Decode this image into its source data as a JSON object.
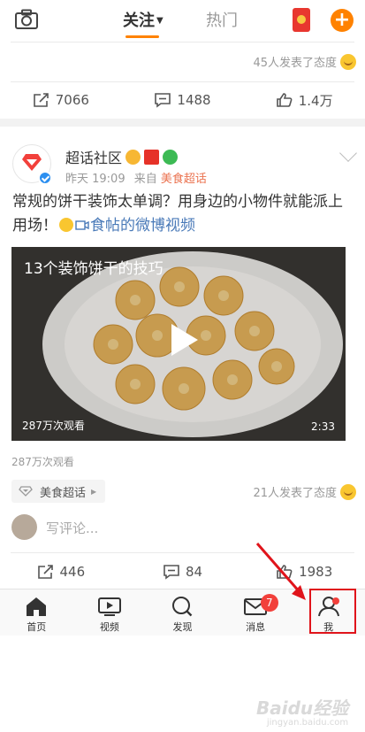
{
  "topbar": {
    "tab_follow": "关注",
    "tab_hot": "热门",
    "accent": "#ff8200"
  },
  "prev_post": {
    "reaction_text": "45人发表了态度",
    "repost_count": "7066",
    "comment_count": "1488",
    "like_count": "1.4万"
  },
  "post": {
    "author": "超话社区",
    "time": "昨天 19:09",
    "from_prefix": "来自",
    "source": "美食超话",
    "text_main": "常规的饼干装饰太单调？用身边的小物件就能派上用场！",
    "link_text": "食帖的微博视频",
    "video": {
      "title": "13个装饰饼干的技巧",
      "views": "287万次观看",
      "duration": "2:33"
    },
    "views_under": "287万次观看",
    "topic_tag": "美食超话",
    "reaction_text": "21人发表了态度",
    "comment_placeholder": "写评论...",
    "repost_count": "446",
    "comment_count": "84",
    "like_count": "1983"
  },
  "bottom_nav": {
    "items": [
      {
        "label": "首页",
        "icon": "home-icon"
      },
      {
        "label": "视频",
        "icon": "video-icon"
      },
      {
        "label": "发现",
        "icon": "discover-icon"
      },
      {
        "label": "消息",
        "icon": "message-icon",
        "badge": "7"
      },
      {
        "label": "我",
        "icon": "profile-icon"
      }
    ]
  },
  "watermark": {
    "brand": "Baidu经验",
    "url": "jingyan.baidu.com"
  }
}
